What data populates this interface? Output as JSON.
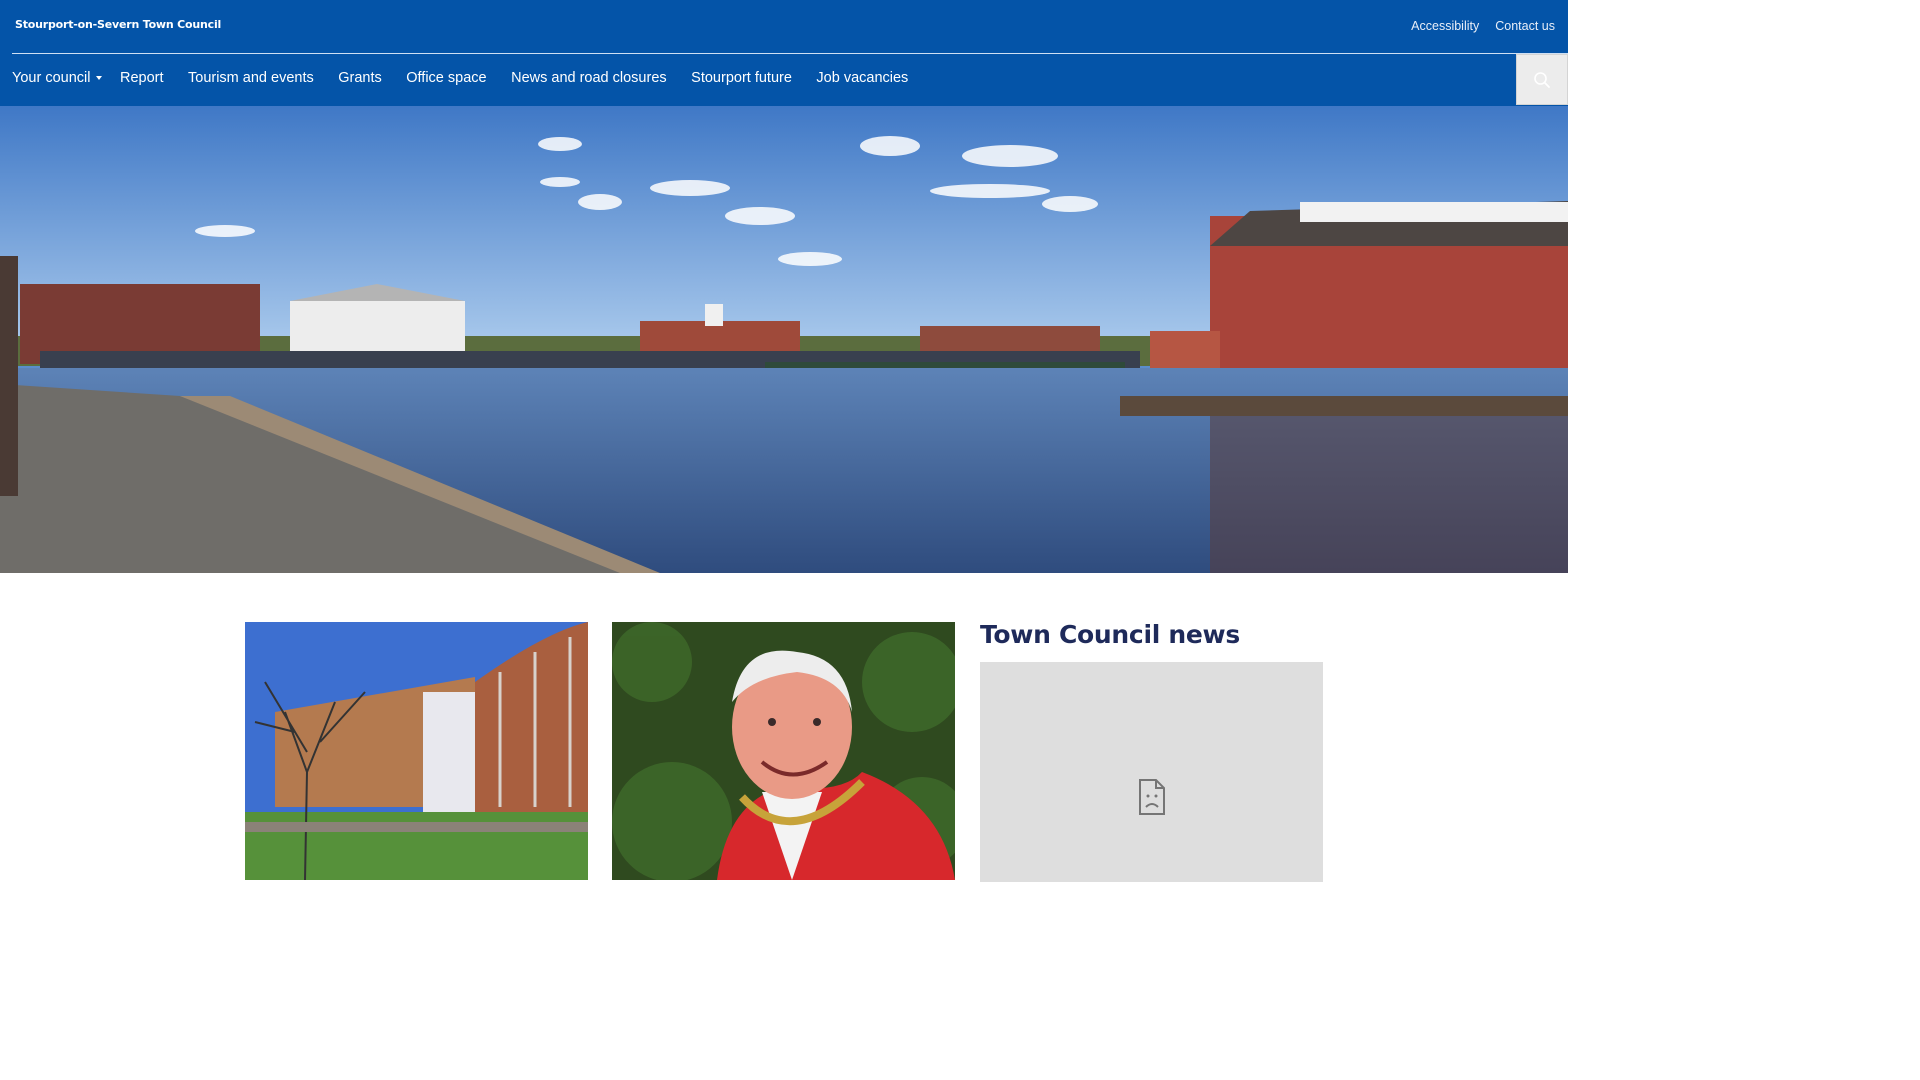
{
  "site": {
    "name": "Stourport-on-Severn Town Council"
  },
  "utility_links": [
    {
      "label": "Accessibility"
    },
    {
      "label": "Contact us"
    }
  ],
  "nav": {
    "items": [
      {
        "label": "Your council",
        "has_dropdown": true
      },
      {
        "label": "Report"
      },
      {
        "label": "Tourism and events"
      },
      {
        "label": "Grants"
      },
      {
        "label": "Office space"
      },
      {
        "label": "News and road closures"
      },
      {
        "label": "Stourport future"
      },
      {
        "label": "Job vacancies"
      }
    ],
    "search_icon": "search-icon"
  },
  "hero": {
    "image": "canal-basin-photo"
  },
  "cards": [
    {
      "image": "office-building-photo"
    },
    {
      "image": "mayor-portrait-photo"
    }
  ],
  "news": {
    "title": "Town Council news",
    "embed_icon": "broken-document-icon"
  },
  "colors": {
    "header_bg": "#0454a8",
    "news_title": "#1e2a5a",
    "embed_bg": "#dedede"
  }
}
